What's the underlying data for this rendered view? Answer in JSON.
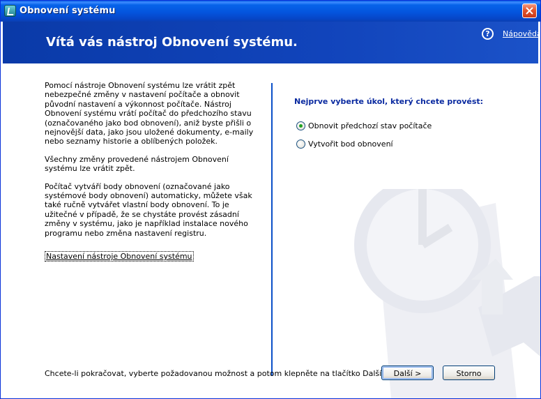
{
  "window": {
    "title": "Obnovení systému",
    "close_icon": "close-icon"
  },
  "header": {
    "heading": "Vítá vás nástroj Obnovení systému.",
    "help_label": "Nápověda",
    "help_icon": "help-icon"
  },
  "intro": {
    "paragraph1": "Pomocí nástroje Obnovení systému lze vrátit zpět nebezpečné změny v nastavení počítače a obnovit původní nastavení a výkonnost počítače. Nástroj Obnovení systému vrátí počítač do předchozího stavu (označovaného jako bod obnovení), aniž byste přišli o nejnovější data, jako jsou uložené dokumenty, e-maily nebo seznamy historie a oblíbených položek.",
    "paragraph2": "Všechny změny provedené nástrojem Obnovení systému lze vrátit zpět.",
    "paragraph3": "Počítač vytváří body obnovení (označované jako systémové body obnovení) automaticky, můžete však také ručně vytvářet vlastní body obnovení. To je užitečné v případě, že se chystáte provést zásadní změny v systému, jako je například instalace nového programu nebo změna nastavení registru.",
    "settings_link": "Nastavení nástroje Obnovení systému"
  },
  "task": {
    "prompt": "Nejprve vyberte úkol, který chcete provést:",
    "options": [
      {
        "label": "Obnovit předchozí stav počítače",
        "selected": true
      },
      {
        "label": "Vytvořit bod obnovení",
        "selected": false
      }
    ]
  },
  "footer": {
    "instruction": "Chcete-li pokračovat, vyberte požadovanou možnost a potom klepněte na tlačítko Další.",
    "next_label": "Další >",
    "cancel_label": "Storno"
  },
  "colors": {
    "header_blue": "#0a3aa8",
    "title_bar_blue": "#0455de",
    "prompt_blue": "#0a2aa0"
  }
}
